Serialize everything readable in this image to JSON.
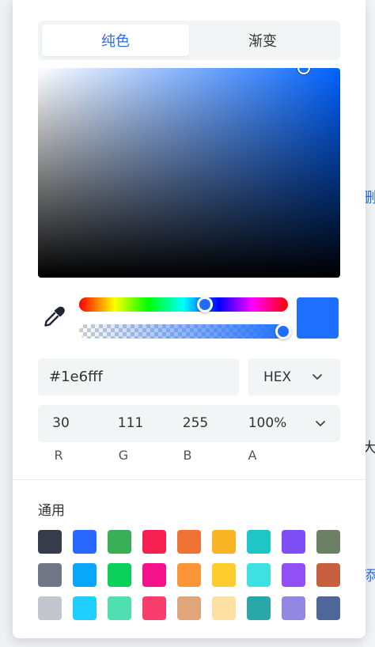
{
  "tabs": [
    {
      "label": "纯色",
      "active": true
    },
    {
      "label": "渐变",
      "active": false
    }
  ],
  "picker": {
    "hue_deg": 217,
    "saturation": 0.88,
    "value": 1.0,
    "alpha": 1.0,
    "current_color": "#1e6fff"
  },
  "hex_input": {
    "value": "#1e6fff"
  },
  "format_select": {
    "label": "HEX"
  },
  "rgba": {
    "values": [
      "30",
      "111",
      "255",
      "100%"
    ],
    "labels": [
      "R",
      "G",
      "B",
      "A"
    ]
  },
  "swatch_section": {
    "title": "通用"
  },
  "swatches": [
    "#363c4c",
    "#2868ff",
    "#39b058",
    "#f51f50",
    "#f07234",
    "#f9b524",
    "#1ec6c6",
    "#7d4ff5",
    "#6b8064",
    "#707888",
    "#0aa6f9",
    "#0acf5b",
    "#f5118a",
    "#fc9536",
    "#fdcc2e",
    "#3de1e0",
    "#9050f5",
    "#c86040",
    "#c3c6ce",
    "#1fcdff",
    "#50dfb0",
    "#f83e6a",
    "#e0a67a",
    "#fde0a2",
    "#2aa7a8",
    "#9287e3",
    "#4f6698"
  ],
  "background_text": [
    "删",
    "大",
    "添"
  ],
  "icons": {
    "eyedropper": "eyedropper-icon",
    "chevron": "chevron-down-icon"
  }
}
